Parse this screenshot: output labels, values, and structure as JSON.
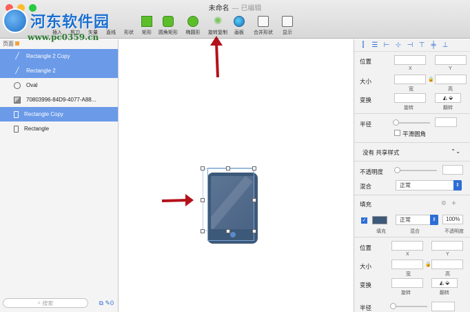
{
  "window": {
    "title": "未命名",
    "subtitle": "— 已编辑"
  },
  "watermark": {
    "title": "河东软件园",
    "url": "www.pc0359.cn"
  },
  "toolbar": {
    "tools": [
      {
        "label": "插入",
        "icon": "insert-icon"
      },
      {
        "label": "剪刀",
        "icon": "scissors-icon"
      },
      {
        "label": "矢量",
        "icon": "vector-icon"
      },
      {
        "label": "直线",
        "icon": "line-icon"
      },
      {
        "label": "形状",
        "icon": "shape-icon"
      },
      {
        "label": "矩形",
        "icon": "rectangle-icon"
      },
      {
        "label": "圆角矩形",
        "icon": "rounded-rectangle-icon"
      },
      {
        "label": "椭圆形",
        "icon": "oval-icon"
      },
      {
        "label": "旋转复制",
        "icon": "rotate-copy-icon"
      },
      {
        "label": "画板",
        "icon": "artboard-icon"
      },
      {
        "label": "合并形状",
        "icon": "combine-shapes-icon"
      },
      {
        "label": "显示",
        "icon": "view-icon"
      }
    ]
  },
  "left_panel": {
    "pages_label": "页面",
    "layers": [
      {
        "name": "Rectangle 2 Copy",
        "type": "line",
        "selected": true
      },
      {
        "name": "Rectangle 2",
        "type": "line",
        "selected": true
      },
      {
        "name": "Oval",
        "type": "oval",
        "selected": false
      },
      {
        "name": "70803996-84D9-4077-A88...",
        "type": "image",
        "selected": false
      },
      {
        "name": "Rectangle Copy",
        "type": "rect",
        "selected": true
      },
      {
        "name": "Rectangle",
        "type": "rect",
        "selected": false
      }
    ],
    "search_placeholder": "搜索",
    "footer_count": "0"
  },
  "inspector": {
    "position_label": "位置",
    "size_label": "大小",
    "transform_label": "变换",
    "x_label": "X",
    "y_label": "Y",
    "width_label": "宽",
    "height_label": "高",
    "rotate_label": "旋转",
    "flip_label": "翻转",
    "radius_label": "半径",
    "smooth_corners_label": "平滑圆角",
    "shared_style": "没有 共享样式",
    "opacity_label": "不透明度",
    "blend_label": "混合",
    "blend_value": "正常",
    "fill_label": "填充",
    "fill_swatch_caption": "填充",
    "fill_blend_value": "正常",
    "fill_blend_caption": "混合",
    "fill_opacity_value": "100%",
    "fill_opacity_caption": "不透明度",
    "fill_color": "#3d5979",
    "accent_color": "#2d6ed6"
  }
}
